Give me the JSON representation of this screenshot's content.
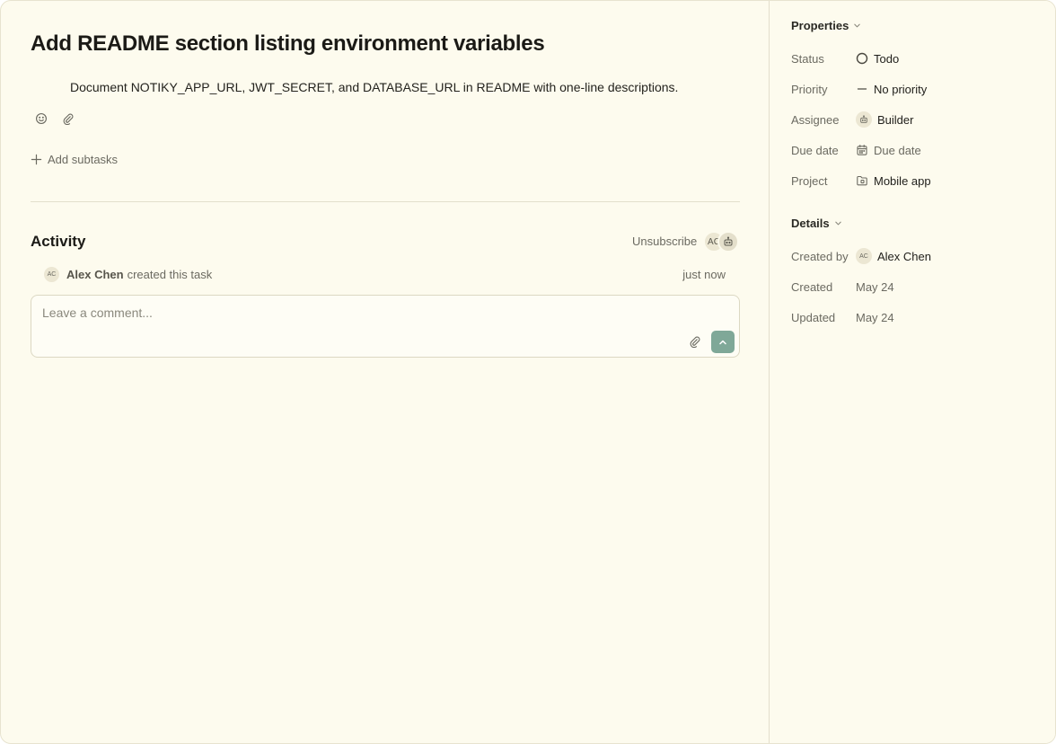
{
  "task": {
    "title": "Add README section listing environment variables",
    "description": "Document NOTIKY_APP_URL, JWT_SECRET, and DATABASE_URL in README with one-line descriptions.",
    "add_subtasks_label": "Add subtasks"
  },
  "activity": {
    "title": "Activity",
    "unsubscribe_label": "Unsubscribe",
    "subscriber_initials": "AC",
    "events": [
      {
        "author_initials": "AC",
        "author": "Alex Chen",
        "action": "created this task",
        "time": "just now"
      }
    ],
    "comment_placeholder": "Leave a comment..."
  },
  "sidebar": {
    "properties_title": "Properties",
    "properties": {
      "status": {
        "label": "Status",
        "value": "Todo"
      },
      "priority": {
        "label": "Priority",
        "value": "No priority"
      },
      "assignee": {
        "label": "Assignee",
        "value": "Builder"
      },
      "due_date": {
        "label": "Due date",
        "value": "Due date"
      },
      "project": {
        "label": "Project",
        "value": "Mobile app"
      }
    },
    "details_title": "Details",
    "details": {
      "created_by": {
        "label": "Created by",
        "initials": "AC",
        "value": "Alex Chen"
      },
      "created": {
        "label": "Created",
        "value": "May 24"
      },
      "updated": {
        "label": "Updated",
        "value": "May 24"
      }
    }
  },
  "colors": {
    "background": "#fdfbee",
    "accent_send": "#7fa898",
    "muted_text": "#6b6a61",
    "border": "#e3dfcc"
  },
  "icons": [
    "emoji-icon",
    "paperclip-icon",
    "plus-icon",
    "bot-icon",
    "send-arrow-icon",
    "chevron-down-icon",
    "status-circle-icon",
    "priority-dash-icon",
    "calendar-icon",
    "folder-icon"
  ]
}
